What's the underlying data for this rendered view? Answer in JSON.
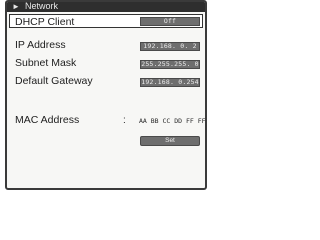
{
  "window": {
    "title": "Network"
  },
  "dhcp": {
    "label": "DHCP Client",
    "value": "Off"
  },
  "ip": {
    "label": "IP Address",
    "value": "192.168.  0.  2"
  },
  "subnet": {
    "label": "Subnet Mask",
    "value": "255.255.255.  0"
  },
  "gateway": {
    "label": "Default Gateway",
    "value": "192.168.  0.254"
  },
  "mac": {
    "label": "MAC Address",
    "separator": ":",
    "value": "AA BB CC DD FF FF"
  },
  "set_button": {
    "label": "Set"
  },
  "colors": {
    "title_bar": "#2e2e2e",
    "field_bg": "#6e6e6e",
    "panel_bg": "#f7f7f5"
  }
}
